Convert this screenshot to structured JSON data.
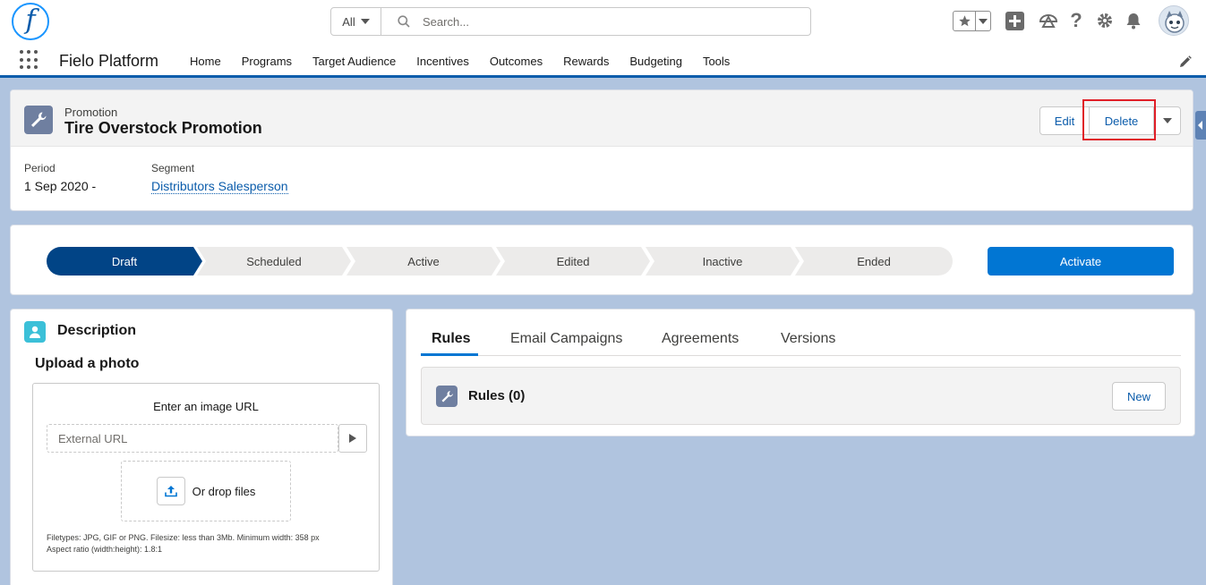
{
  "header": {
    "search_scope": "All",
    "search_placeholder": "Search...",
    "icons": [
      "favorites-star-icon",
      "favorites-dropdown-icon",
      "global-add-icon",
      "trailhead-icon",
      "help-icon",
      "setup-gear-icon",
      "notifications-bell-icon",
      "user-avatar"
    ]
  },
  "app": {
    "name": "Fielo Platform",
    "nav": [
      "Home",
      "Programs",
      "Target Audience",
      "Incentives",
      "Outcomes",
      "Rewards",
      "Budgeting",
      "Tools"
    ]
  },
  "record": {
    "object_type": "Promotion",
    "title": "Tire Overstock Promotion",
    "actions": {
      "edit": "Edit",
      "delete": "Delete"
    },
    "fields": {
      "period_label": "Period",
      "period_value": "1 Sep 2020 -",
      "segment_label": "Segment",
      "segment_value": "Distributors Salesperson"
    }
  },
  "path": {
    "stages": [
      "Draft",
      "Scheduled",
      "Active",
      "Edited",
      "Inactive",
      "Ended"
    ],
    "current_stage": "Draft",
    "action": "Activate"
  },
  "description": {
    "title": "Description",
    "upload_title": "Upload a photo",
    "enter_url_label": "Enter an image URL",
    "url_placeholder": "External URL",
    "drop_text": "Or drop files",
    "help_line1": "Filetypes: JPG, GIF or PNG. Filesize: less than 3Mb. Minimum width: 358 px",
    "help_line2": "Aspect ratio (width:height): 1.8:1"
  },
  "tabs": {
    "items": [
      "Rules",
      "Email Campaigns",
      "Agreements",
      "Versions"
    ],
    "active": "Rules"
  },
  "related": {
    "title": "Rules (0)",
    "new_label": "New"
  },
  "colors": {
    "brand": "#0176d3",
    "path_current": "#014486",
    "highlight_border": "#e01e27",
    "page_background": "#b0c4df"
  }
}
